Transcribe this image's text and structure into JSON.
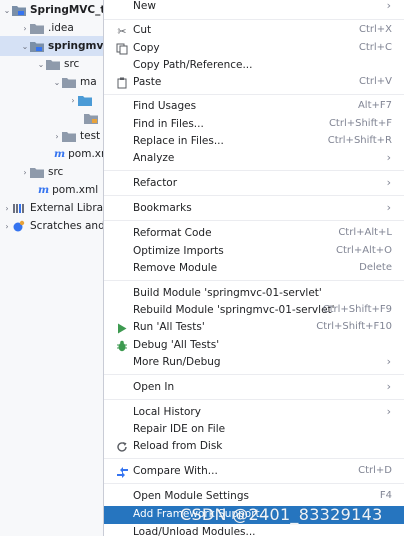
{
  "tree": {
    "items": [
      {
        "label": "SpringMVC_t",
        "chev": "⌄",
        "indent": 0
      },
      {
        "label": ".idea",
        "chev": "›",
        "indent": 1
      },
      {
        "label": "springmvc",
        "chev": "⌄",
        "indent": 1
      },
      {
        "label": "src",
        "chev": "⌄",
        "indent": 2
      },
      {
        "label": "ma",
        "chev": "⌄",
        "indent": 3
      },
      {
        "label": "",
        "chev": "›",
        "indent": 4
      },
      {
        "label": "",
        "chev": "",
        "indent": 5
      },
      {
        "label": "test",
        "chev": "›",
        "indent": 3
      },
      {
        "label": "pom.xn",
        "chev": "",
        "indent": 3
      },
      {
        "label": "src",
        "chev": "›",
        "indent": 1
      },
      {
        "label": "pom.xml",
        "chev": "",
        "indent": 1
      },
      {
        "label": "External Libra",
        "chev": "›",
        "indent": 0
      },
      {
        "label": "Scratches and",
        "chev": "›",
        "indent": 0
      }
    ]
  },
  "menu": {
    "new": "New",
    "cut": "Cut",
    "cut_sc": "Ctrl+X",
    "copy": "Copy",
    "copy_sc": "Ctrl+C",
    "copy_path": "Copy Path/Reference...",
    "paste": "Paste",
    "paste_sc": "Ctrl+V",
    "find_usages": "Find Usages",
    "find_usages_sc": "Alt+F7",
    "find_in_files": "Find in Files...",
    "find_in_files_sc": "Ctrl+Shift+F",
    "replace_in_files": "Replace in Files...",
    "replace_in_files_sc": "Ctrl+Shift+R",
    "analyze": "Analyze",
    "refactor": "Refactor",
    "bookmarks": "Bookmarks",
    "reformat": "Reformat Code",
    "reformat_sc": "Ctrl+Alt+L",
    "optimize": "Optimize Imports",
    "optimize_sc": "Ctrl+Alt+O",
    "remove_module": "Remove Module",
    "remove_module_sc": "Delete",
    "build_module": "Build Module 'springmvc-01-servlet'",
    "rebuild_module": "Rebuild Module 'springmvc-01-servlet'",
    "rebuild_module_sc": "Ctrl+Shift+F9",
    "run_tests": "Run 'All Tests'",
    "run_tests_sc": "Ctrl+Shift+F10",
    "debug_tests": "Debug 'All Tests'",
    "more_run": "More Run/Debug",
    "open_in": "Open In",
    "local_history": "Local History",
    "repair_ide": "Repair IDE on File",
    "reload": "Reload from Disk",
    "compare": "Compare With...",
    "compare_sc": "Ctrl+D",
    "module_settings": "Open Module Settings",
    "module_settings_sc": "F4",
    "add_framework": "Add Framework Support...",
    "load_unload": "Load/Unload Modules..."
  },
  "watermark": "CSDN @2401_83329143",
  "colors": {
    "highlight": "#2675bf",
    "selected_tree_row": "#d5e1f5",
    "run_icon": "#3d9a50",
    "debug_icon": "#3d9a50",
    "maven_icon": "#3574f0"
  }
}
